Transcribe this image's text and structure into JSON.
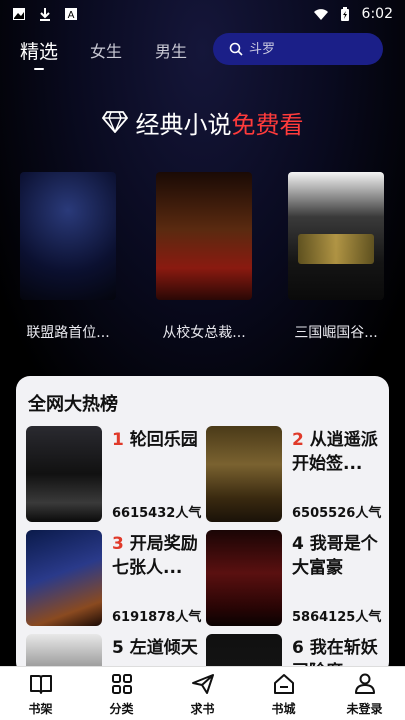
{
  "status_bar": {
    "time": "6:02"
  },
  "nav": {
    "tabs": [
      {
        "label": "精选",
        "active": true
      },
      {
        "label": "女生",
        "active": false
      },
      {
        "label": "男生",
        "active": false
      }
    ],
    "search_placeholder": "斗罗"
  },
  "banner": {
    "part1": "经典小说",
    "part2": "免费看"
  },
  "featured": [
    {
      "title": "联盟路首位..."
    },
    {
      "title": "从校女总裁..."
    },
    {
      "title": "三国崛国谷..."
    }
  ],
  "hot_list": {
    "title": "全网大热榜",
    "items": [
      {
        "rank": "1",
        "name": "轮回乐园",
        "popularity": "6615432人气"
      },
      {
        "rank": "2",
        "name": "从逍遥派开始签...",
        "popularity": "6505526人气"
      },
      {
        "rank": "3",
        "name": "开局奖励七张人...",
        "popularity": "6191878人气"
      },
      {
        "rank": "4",
        "name": "我哥是个大富豪",
        "popularity": "5864125人气"
      },
      {
        "rank": "5",
        "name": "左道倾天",
        "popularity": ""
      },
      {
        "rank": "6",
        "name": "我在斩妖司除魔",
        "popularity": ""
      }
    ]
  },
  "bottom_nav": [
    {
      "label": "书架",
      "icon": "book-icon"
    },
    {
      "label": "分类",
      "icon": "grid-icon"
    },
    {
      "label": "求书",
      "icon": "send-icon"
    },
    {
      "label": "书城",
      "icon": "home-icon"
    },
    {
      "label": "未登录",
      "icon": "user-icon"
    }
  ],
  "colors": {
    "accent_red": "#ff3b3b",
    "search_bg": "#1b1f88",
    "rank_red": "#e03a2a"
  }
}
